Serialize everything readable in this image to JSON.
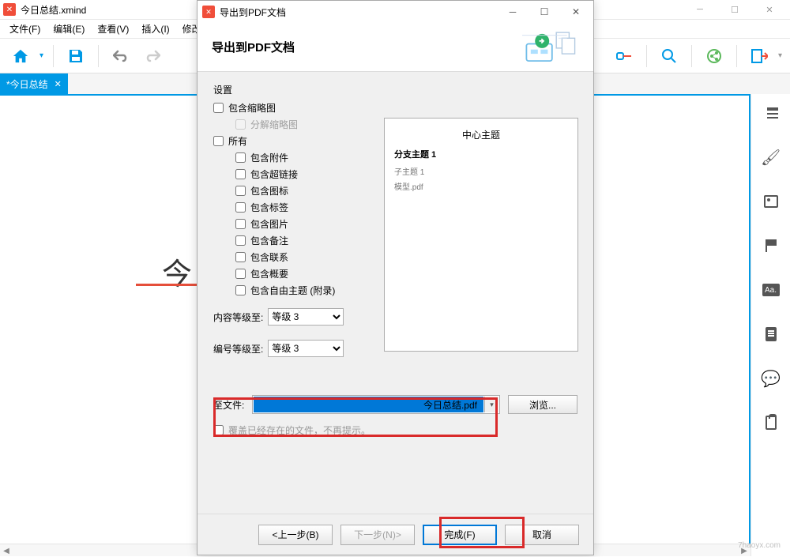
{
  "main_window": {
    "title": "今日总结.xmind",
    "menus": [
      "文件(F)",
      "编辑(E)",
      "查看(V)",
      "插入(I)",
      "修改(M)"
    ],
    "tab_title": "*今日总结",
    "canvas_title_fragment": "今日"
  },
  "right_panel": {
    "aa_label": "Aa."
  },
  "dialog": {
    "titlebar": "导出到PDF文档",
    "heading": "导出到PDF文档",
    "settings_label": "设置",
    "checkboxes": {
      "include_thumbnail": "包含缩略图",
      "split_thumbnail": "分解缩略图",
      "all": "所有",
      "include_attachment": "包含附件",
      "include_hyperlink": "包含超链接",
      "include_icon": "包含图标",
      "include_label": "包含标签",
      "include_image": "包含图片",
      "include_note": "包含备注",
      "include_relationship": "包含联系",
      "include_summary": "包含概要",
      "include_floating": "包含自由主题 (附录)"
    },
    "content_level_label": "内容等级至:",
    "number_level_label": "编号等级至:",
    "level_value": "等级 3",
    "file_label": "至文件:",
    "file_value": "今日总结.pdf",
    "browse": "浏览...",
    "overwrite_label": "覆盖已经存在的文件，不再提示。",
    "back": "<上一步(B)",
    "next": "下一步(N)>",
    "finish": "完成(F)",
    "cancel": "取消"
  },
  "preview": {
    "center": "中心主题",
    "branch": "分支主题 1",
    "sub": "子主题 1",
    "file": "模型.pdf"
  },
  "watermark": "7haoyx.com"
}
